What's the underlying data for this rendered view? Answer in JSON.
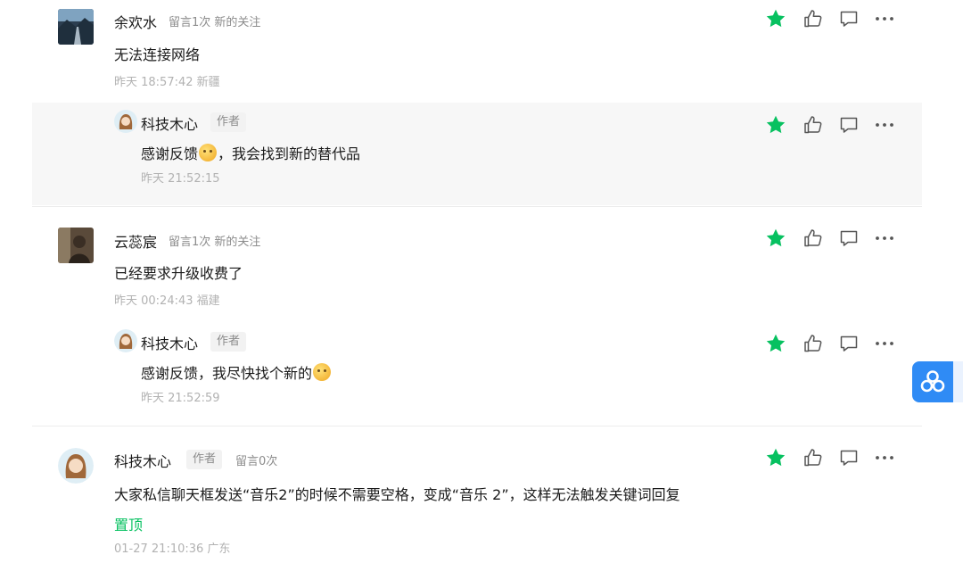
{
  "comments": [
    {
      "name": "余欢水",
      "meta": "留言1次 新的关注",
      "content": "无法连接网络",
      "time": "昨天 18:57:42 新疆",
      "reply": {
        "name": "科技木心",
        "badge": "作者",
        "content_before": "感谢反馈",
        "emoji": "smiling-face-emoji",
        "content_after": "，我会找到新的替代品",
        "time": "昨天 21:52:15"
      }
    },
    {
      "name": "云蕊宸",
      "meta": "留言1次 新的关注",
      "content": "已经要求升级收费了",
      "time": "昨天 00:24:43 福建",
      "reply": {
        "name": "科技木心",
        "badge": "作者",
        "content_before": "感谢反馈，我尽快找个新的",
        "emoji": "pensive-face-emoji",
        "content_after": "",
        "time": "昨天 21:52:59"
      }
    },
    {
      "name": "科技木心",
      "badge": "作者",
      "meta": "留言0次",
      "content": "大家私信聊天框发送“音乐2”的时候不需要空格，变成“音乐 2”，这样无法触发关键词回复",
      "pinned": "置顶",
      "time": "01-27 21:10:36 广东"
    }
  ],
  "icons": [
    "star-icon",
    "thumbs-up-icon",
    "comment-icon",
    "more-icon",
    "floating-app-icon"
  ],
  "colors": {
    "accent": "#07c160",
    "float_button": "#2f8bf5"
  }
}
